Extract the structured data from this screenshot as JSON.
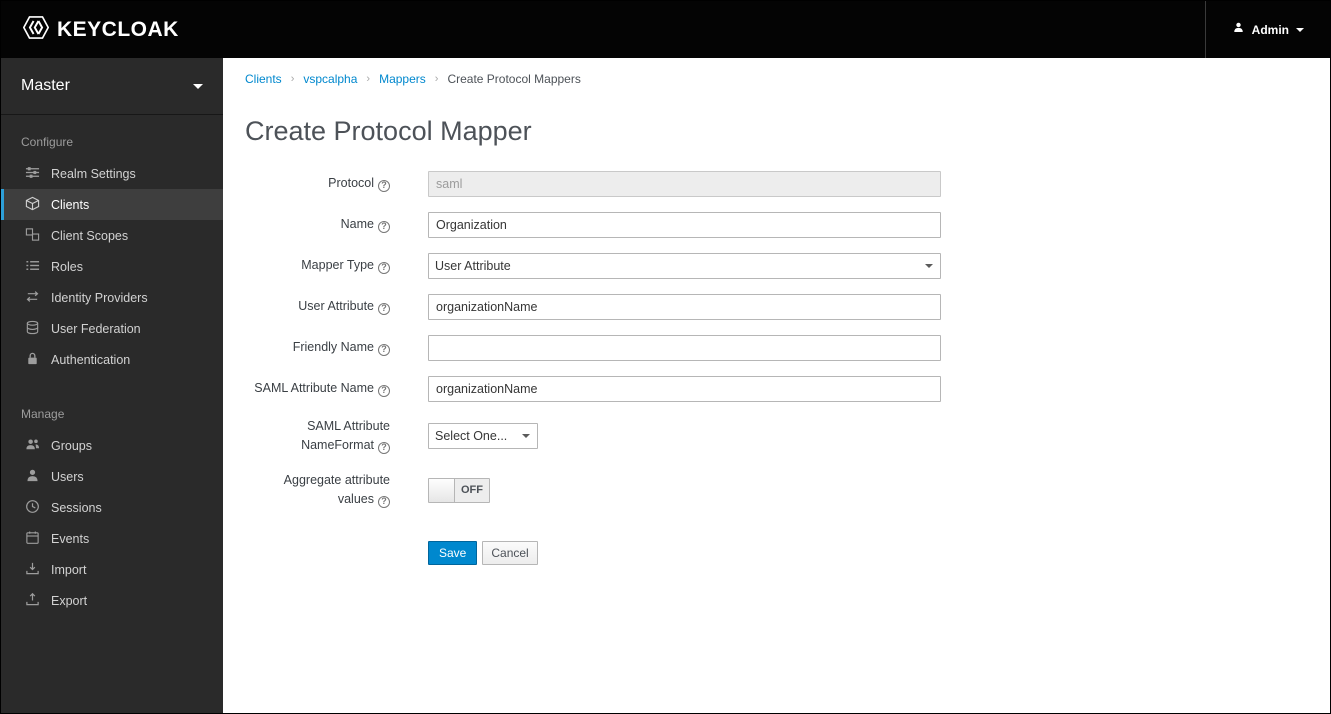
{
  "topbar": {
    "logo_text": "KEYCLOAK",
    "admin": {
      "label": "Admin"
    }
  },
  "sidebar": {
    "realm": "Master",
    "sections": {
      "configure": {
        "label": "Configure",
        "items": [
          {
            "label": "Realm Settings",
            "icon": "sliders-icon"
          },
          {
            "label": "Clients",
            "icon": "cube-icon",
            "selected": true
          },
          {
            "label": "Client Scopes",
            "icon": "cubes-icon"
          },
          {
            "label": "Roles",
            "icon": "list-icon"
          },
          {
            "label": "Identity Providers",
            "icon": "exchange-icon"
          },
          {
            "label": "User Federation",
            "icon": "database-icon"
          },
          {
            "label": "Authentication",
            "icon": "lock-icon"
          }
        ]
      },
      "manage": {
        "label": "Manage",
        "items": [
          {
            "label": "Groups",
            "icon": "users-icon"
          },
          {
            "label": "Users",
            "icon": "user-icon"
          },
          {
            "label": "Sessions",
            "icon": "clock-icon"
          },
          {
            "label": "Events",
            "icon": "calendar-icon"
          },
          {
            "label": "Import",
            "icon": "import-icon"
          },
          {
            "label": "Export",
            "icon": "export-icon"
          }
        ]
      }
    }
  },
  "breadcrumb": {
    "items": [
      "Clients",
      "vspcalpha",
      "Mappers",
      "Create Protocol Mappers"
    ]
  },
  "page": {
    "title": "Create Protocol Mapper"
  },
  "form": {
    "protocol": {
      "label": "Protocol",
      "value": "saml",
      "disabled": true
    },
    "name": {
      "label": "Name",
      "value": "Organization"
    },
    "mapper_type": {
      "label": "Mapper Type",
      "value": "User Attribute"
    },
    "user_attribute": {
      "label": "User Attribute",
      "value": "organizationName"
    },
    "friendly_name": {
      "label": "Friendly Name",
      "value": ""
    },
    "saml_attribute_name": {
      "label": "SAML Attribute Name",
      "value": "organizationName"
    },
    "saml_attribute_nameformat": {
      "label": "SAML Attribute NameFormat",
      "value": "Select One..."
    },
    "aggregate_attribute_values": {
      "label": "Aggregate attribute values",
      "state": "OFF"
    },
    "actions": {
      "save": "Save",
      "cancel": "Cancel"
    }
  },
  "colors": {
    "topbar_bg": "#040404",
    "sidebar_bg": "#2a2a2a",
    "selected_item_border": "#2d9fd8",
    "accent_blue": "#0088ce",
    "link_blue": "#0088ce"
  }
}
